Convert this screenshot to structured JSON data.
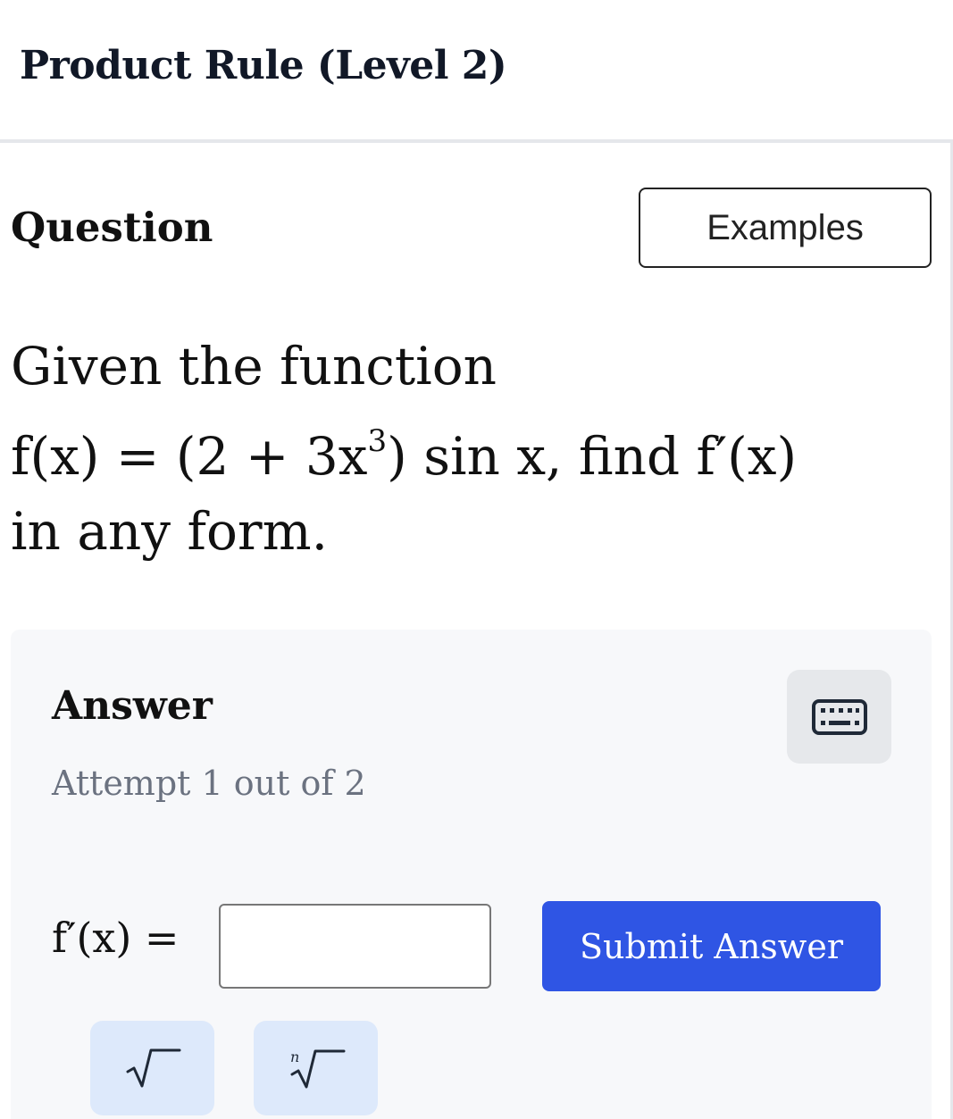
{
  "header": {
    "title": "Product Rule (Level 2)"
  },
  "question": {
    "heading": "Question",
    "examples_label": "Examples",
    "intro": "Given the function",
    "function_lhs": "f(x) = ",
    "function_rhs_open": "(2 + 3x",
    "function_exponent": "3",
    "function_rhs_close": ") sin x,",
    "find_text": " find ",
    "target": "f′(x)",
    "outro": "in any form."
  },
  "answer": {
    "heading": "Answer",
    "attempt": "Attempt 1 out of 2",
    "label": "f′(x) =",
    "input_value": "",
    "submit_label": "Submit Answer",
    "keyboard_icon": "keyboard-icon",
    "tools": [
      {
        "icon": "square-root-icon"
      },
      {
        "icon": "nth-root-icon",
        "index_glyph": "n"
      }
    ]
  },
  "colors": {
    "submit_bg": "#2f55e4",
    "tool_bg": "#dde9fb",
    "panel_bg": "#f7f8fa",
    "muted_text": "#6b7280"
  }
}
